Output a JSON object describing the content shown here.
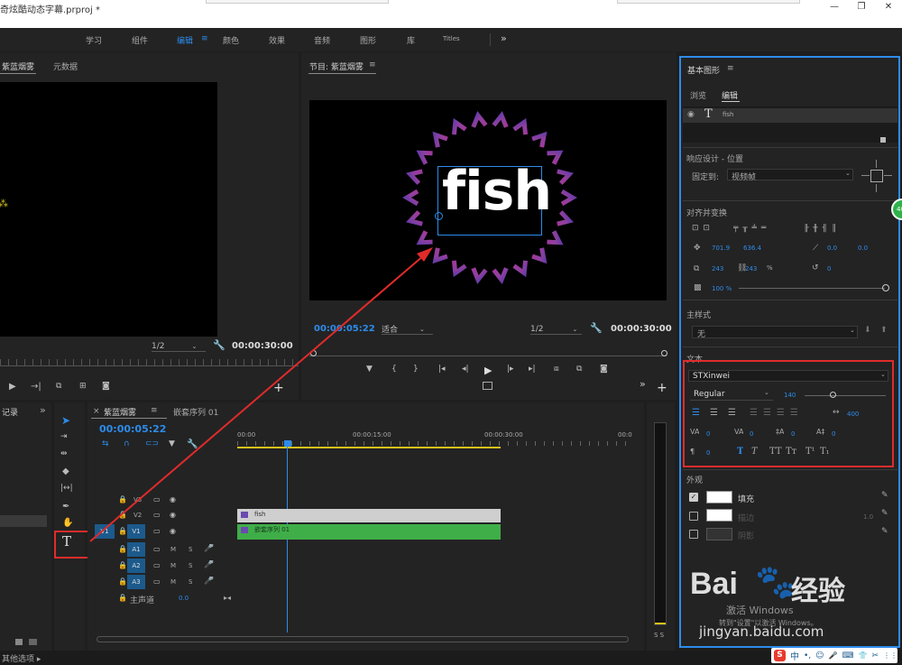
{
  "window": {
    "title": "奇炫酷动态字幕.prproj *",
    "min": "—",
    "restore": "❐",
    "close": "✕"
  },
  "menu": {
    "items": [
      "学习",
      "组件",
      "编辑",
      "颜色",
      "效果",
      "音频",
      "图形",
      "库",
      "Titles"
    ],
    "active_index": 2,
    "more": "»",
    "active_icon": "≡"
  },
  "source": {
    "tab": "紫蓝烟雾",
    "tab2": "元数据",
    "zoom": "1/2",
    "timecode": "00:00:30:00"
  },
  "program": {
    "title": "节目: 紫蓝烟雾",
    "menu_icon": "≡",
    "text": "fish",
    "timecode_left": "00:00:05:22",
    "fit": "适合",
    "zoom": "1/2",
    "timecode_right": "00:00:30:00"
  },
  "project": {
    "tab": "记录",
    "more": "»"
  },
  "timeline": {
    "tab1": "紫蓝烟雾",
    "tab2": "嵌套序列 01",
    "timecode": "00:00:05:22",
    "ruler": [
      "00:00",
      "00:00:15:00",
      "00:00:30:00",
      "00:0"
    ],
    "tracks": [
      {
        "name": "V3",
        "label": "V3",
        "type": "v"
      },
      {
        "name": "V2",
        "label": "V2",
        "type": "v"
      },
      {
        "name": "V1",
        "label": "V1",
        "type": "v",
        "source": "V1"
      },
      {
        "name": "A1",
        "label": "A1",
        "type": "a"
      },
      {
        "name": "A2",
        "label": "A2",
        "type": "a"
      },
      {
        "name": "A3",
        "label": "A3",
        "type": "a"
      }
    ],
    "master": {
      "label": "主声道",
      "value": "0.0"
    },
    "clips": {
      "fish": "fish",
      "nested": "嵌套序列 01"
    },
    "m": "M",
    "s": "S"
  },
  "eg": {
    "title": "基本图形",
    "menu_icon": "≡",
    "tab_browse": "浏览",
    "tab_edit": "编辑",
    "layer": "fish",
    "layer_icon": "T",
    "responsive": "响应设计 - 位置",
    "pin_label": "固定到:",
    "pin_value": "视频帧",
    "align": "对齐并变换",
    "pos_x": "701.9",
    "pos_y": "636.4",
    "anchor_x": "0.0",
    "anchor_y": "0.0",
    "scale_w": "243",
    "scale_h": "243",
    "scale_unit": "%",
    "rotation": "0",
    "opacity": "100 %",
    "master_style": "主样式",
    "master_style_value": "无",
    "text_section": "文本",
    "font": "STXinwei",
    "font_style": "Regular",
    "font_size": "140",
    "tracking_val": "400",
    "kerning": "0",
    "leading": "0",
    "baseline": "0",
    "tsume": "0",
    "indent": "0",
    "appearance": "外观",
    "fill": "填充",
    "stroke": "描边",
    "stroke_val": "1.0",
    "shadow": "阴影",
    "fill_checked": true
  },
  "status": {
    "text": "其他选项 ▸",
    "vu": "S S"
  },
  "watermark": {
    "baidu": "Bai",
    "du": "经验",
    "url": "jingyan.baidu.com",
    "win1": "激活 Windows",
    "win2": "转到\"设置\"以激活 Windows。",
    "badge": "40"
  },
  "tray": {
    "icons": [
      "S",
      "中",
      "•,",
      "☺",
      "🎤",
      "⌨",
      "👕",
      "✂",
      "⋮⋮"
    ]
  },
  "colors": {
    "accent": "#2d8ceb",
    "red": "#e02b2b",
    "clip_fish": "#cfcfcf",
    "clip_nested": "#3fae49"
  }
}
